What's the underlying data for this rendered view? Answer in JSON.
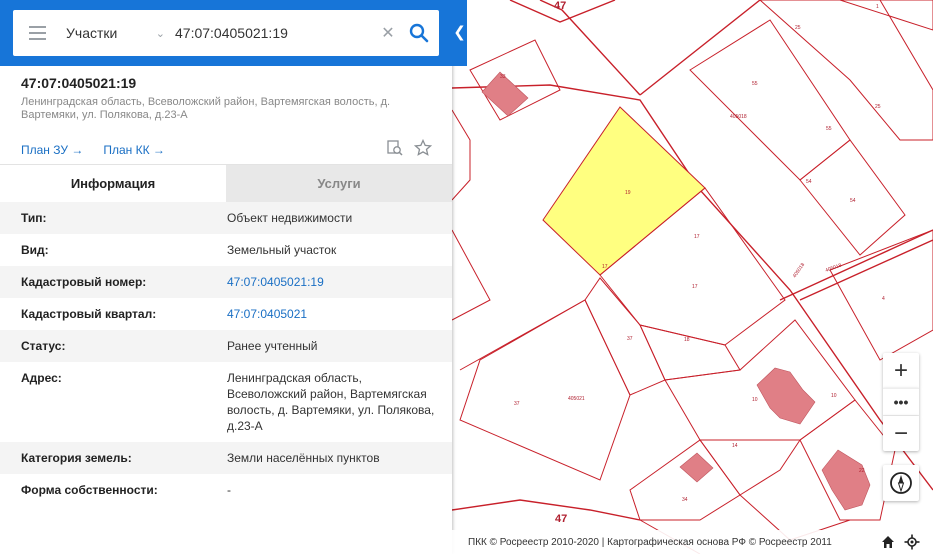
{
  "search": {
    "type_label": "Участки",
    "query": "47:07:0405021:19"
  },
  "object": {
    "number": "47:07:0405021:19",
    "address": "Ленинградская область, Всеволожский район, Вартемягская волость, д. Вартемяки, ул. Полякова, д.23-А"
  },
  "links": {
    "plan_zu": "План ЗУ →",
    "plan_kk": "План КК →"
  },
  "tabs": {
    "info": "Информация",
    "services": "Услуги"
  },
  "rows": [
    {
      "key": "Тип:",
      "value": "Объект недвижимости"
    },
    {
      "key": "Вид:",
      "value": "Земельный участок"
    },
    {
      "key": "Кадастровый номер:",
      "value": "47:07:0405021:19"
    },
    {
      "key": "Кадастровый квартал:",
      "value": "47:07:0405021"
    },
    {
      "key": "Статус:",
      "value": "Ранее учтенный"
    },
    {
      "key": "Адрес:",
      "value": "Ленинградская область, Всеволожский район, Вартемягская волость, д. Вартемяки, ул. Полякова, д.23-А"
    },
    {
      "key": "Категория земель:",
      "value": "Земли населённых пунктов"
    },
    {
      "key": "Форма собственности:",
      "value": "-"
    }
  ],
  "map": {
    "labels": {
      "region_top": "47",
      "region_bottom": "47",
      "quarter_1": "405018",
      "quarter_2": "405021",
      "road_1": "405018",
      "road_2": "405018",
      "p19": "19",
      "p17a": "17",
      "p17b": "17",
      "p17c": "17",
      "p18": "18",
      "p37a": "37",
      "p37b": "37",
      "p55a": "55",
      "p55b": "55",
      "p54a": "54",
      "p54b": "54",
      "p25a": "25",
      "p25b": "25",
      "p1": "1",
      "p4": "4",
      "p10a": "10",
      "p10b": "10",
      "p14": "14",
      "p34": "34",
      "p33": "33",
      "p22": "22"
    }
  },
  "controls": {
    "zoom_in": "+",
    "zoom_more": "•••",
    "zoom_out": "−"
  },
  "footer": {
    "text": "ПКК © Росреестр 2010-2020 | Картографическая основа РФ © Росреестр 2011"
  },
  "colors": {
    "header_bar": "#1775d8",
    "selected_parcel": "#ffff80",
    "parcel_border": "#c8202a",
    "building": "#e07f86",
    "link": "#1a6fc4"
  }
}
